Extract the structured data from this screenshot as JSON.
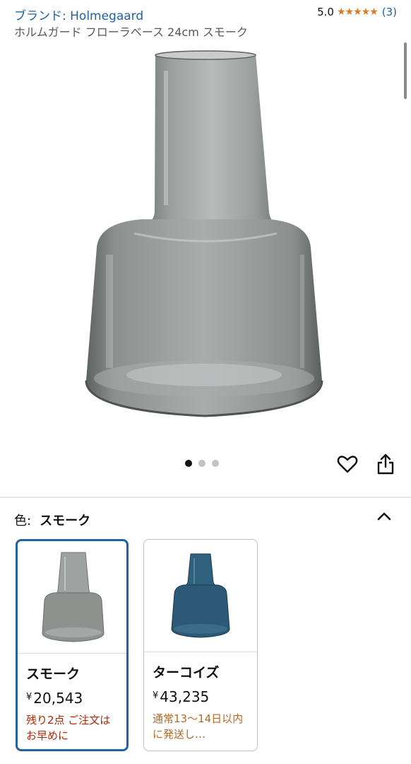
{
  "header": {
    "brand": "ブランド: Holmegaard",
    "title": "ホルムガード フローラベース 24cm スモーク",
    "rating": "5.0",
    "stars": "★★★★★",
    "rating_count": "(3)"
  },
  "gallery": {
    "image": "smoke-glass-vase-icon",
    "dots_count": 3,
    "active_dot": 1
  },
  "actions": {
    "heart": "heart-icon",
    "share": "share-icon"
  },
  "variation": {
    "label": "色:",
    "selected": "スモーク",
    "options": [
      {
        "name": "スモーク",
        "yen": "¥",
        "price": "20,543",
        "note": "残り2点 ご注文はお早めに",
        "note_color": "#b12704",
        "glass_color": "#8d928f"
      },
      {
        "name": "ターコイズ",
        "yen": "¥",
        "price": "43,235",
        "note": "通常13～14日以内に発送し…",
        "note_color": "#b46a24",
        "glass_color": "#2c5a76"
      }
    ]
  },
  "colors": {
    "link": "#2162a1",
    "star": "#de7921",
    "selected_border": "#2162a1"
  }
}
